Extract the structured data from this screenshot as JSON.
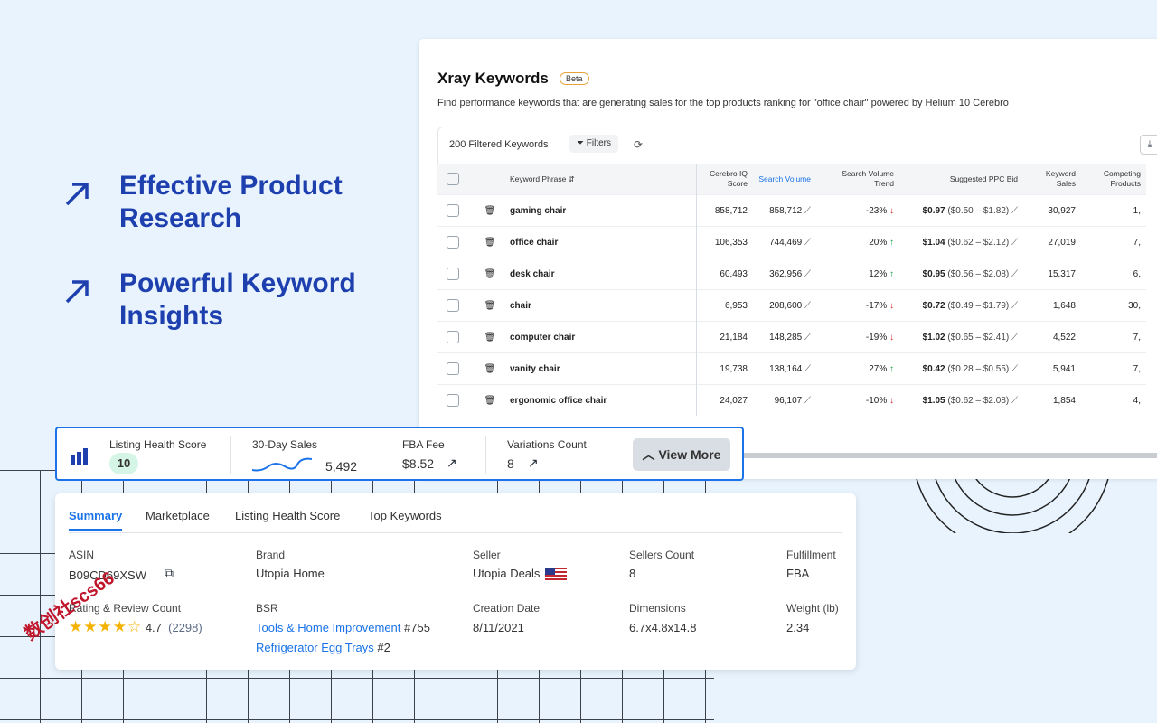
{
  "promo": [
    {
      "text": "Effective Product Research"
    },
    {
      "text": "Powerful Keyword Insights"
    }
  ],
  "xray": {
    "title": "Xray Keywords",
    "badge": "Beta",
    "description": "Find performance keywords that are generating sales for the top products ranking for \"office chair\" powered by Helium 10 Cerebro",
    "filtered_count": "200 Filtered Keywords",
    "filters_label": "Filters",
    "columns": [
      "Keyword Phrase",
      "Cerebro IQ Score",
      "Search Volume",
      "Search Volume Trend",
      "Suggested PPC Bid",
      "Keyword Sales",
      "Competing Products"
    ],
    "rows": [
      {
        "phrase": "gaming chair",
        "iq": "858,712",
        "volume": "858,712",
        "trend": "-23%",
        "dir": "down",
        "bid": "$0.97",
        "range": "($0.50 – $1.82)",
        "sales": "30,927",
        "competing": "1,"
      },
      {
        "phrase": "office chair",
        "iq": "106,353",
        "volume": "744,469",
        "trend": "20%",
        "dir": "up",
        "bid": "$1.04",
        "range": "($0.62 – $2.12)",
        "sales": "27,019",
        "competing": "7,"
      },
      {
        "phrase": "desk chair",
        "iq": "60,493",
        "volume": "362,956",
        "trend": "12%",
        "dir": "up",
        "bid": "$0.95",
        "range": "($0.56 – $2.08)",
        "sales": "15,317",
        "competing": "6,"
      },
      {
        "phrase": "chair",
        "iq": "6,953",
        "volume": "208,600",
        "trend": "-17%",
        "dir": "down",
        "bid": "$0.72",
        "range": "($0.49 – $1.79)",
        "sales": "1,648",
        "competing": "30,"
      },
      {
        "phrase": "computer chair",
        "iq": "21,184",
        "volume": "148,285",
        "trend": "-19%",
        "dir": "down",
        "bid": "$1.02",
        "range": "($0.65 – $2.41)",
        "sales": "4,522",
        "competing": "7,"
      },
      {
        "phrase": "vanity chair",
        "iq": "19,738",
        "volume": "138,164",
        "trend": "27%",
        "dir": "up",
        "bid": "$0.42",
        "range": "($0.28 – $0.55)",
        "sales": "5,941",
        "competing": "7,"
      },
      {
        "phrase": "ergonomic office chair",
        "iq": "24,027",
        "volume": "96,107",
        "trend": "-10%",
        "dir": "down",
        "bid": "$1.05",
        "range": "($0.62 – $2.08)",
        "sales": "1,854",
        "competing": "4,"
      }
    ]
  },
  "health_bar": {
    "listing_health_label": "Listing Health Score",
    "listing_health_value": "10",
    "sales_label": "30-Day Sales",
    "sales_value": "5,492",
    "fba_label": "FBA Fee",
    "fba_value": "$8.52",
    "variations_label": "Variations Count",
    "variations_value": "8",
    "view_more": "View More"
  },
  "summary": {
    "tabs": [
      "Summary",
      "Marketplace",
      "Listing Health Score",
      "Top Keywords"
    ],
    "asin_label": "ASIN",
    "asin": "B09CD69XSW",
    "brand_label": "Brand",
    "brand": "Utopia Home",
    "seller_label": "Seller",
    "seller": "Utopia Deals",
    "sellers_count_label": "Sellers Count",
    "sellers_count": "8",
    "fulfillment_label": "Fulfillment",
    "fulfillment": "FBA",
    "rating_label": "Rating & Review Count",
    "rating": "4.7",
    "reviews": "(2298)",
    "bsr_label": "BSR",
    "bsr1_cat": "Tools & Home Improvement",
    "bsr1_rank": "#755",
    "bsr2_cat": "Refrigerator Egg Trays",
    "bsr2_rank": "#2",
    "creation_label": "Creation Date",
    "creation": "8/11/2021",
    "dimensions_label": "Dimensions",
    "dimensions": "6.7x4.8x14.8",
    "weight_label": "Weight (lb)",
    "weight": "2.34"
  },
  "watermark": "数创社scs66"
}
